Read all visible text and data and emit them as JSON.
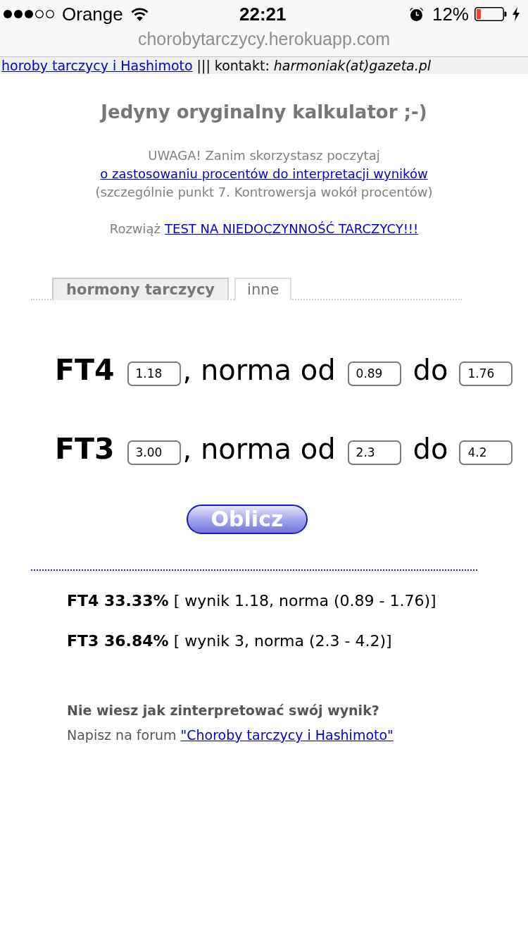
{
  "status_bar": {
    "carrier": "Orange",
    "time": "22:21",
    "battery": "12%"
  },
  "address_bar": {
    "url": "chorobytarczycy.herokuapp.com"
  },
  "top_bar": {
    "link": "horoby tarczycy i Hashimoto",
    "text": "||| kontakt:",
    "email": "harmoniak(at)gazeta.pl"
  },
  "title": "Jedyny oryginalny kalkulator ;-)",
  "notice": {
    "text": "UWAGA! Zanim skorzystasz poczytaj",
    "link": "o zastosowaniu procentów do interpretacji wyników",
    "note": "(szczególnie punkt 7. Kontrowersja wokół procentów)"
  },
  "test": {
    "label": "Rozwiąż",
    "link": "TEST NA NIEDOCZYNNOŚĆ TARCZYCY!!!"
  },
  "tabs": [
    {
      "label": "hormony tarczycy",
      "selected": true
    },
    {
      "label": "inne",
      "selected": false
    }
  ],
  "form": {
    "rows": [
      {
        "hormone": "FT4",
        "value": "1.18",
        "from_label": ", norma od",
        "min": "0.89",
        "to_label": "do",
        "max": "1.76"
      },
      {
        "hormone": "FT3",
        "value": "3.00",
        "from_label": ", norma od",
        "min": "2.3",
        "to_label": "do",
        "max": "4.2"
      }
    ],
    "button": "Oblicz"
  },
  "results": [
    "**FT4 33.33%** [ wynik 1.18, norma (0.89 - 1.76)]",
    "**FT3 36.84%** [ wynik 3, norma (2.3 - 4.2)]"
  ],
  "help": {
    "question": "Nie wiesz jak zinterpretować swój wynik?",
    "text": "Napisz na forum",
    "link": "\"Choroby tarczycy i Hashimoto\""
  }
}
